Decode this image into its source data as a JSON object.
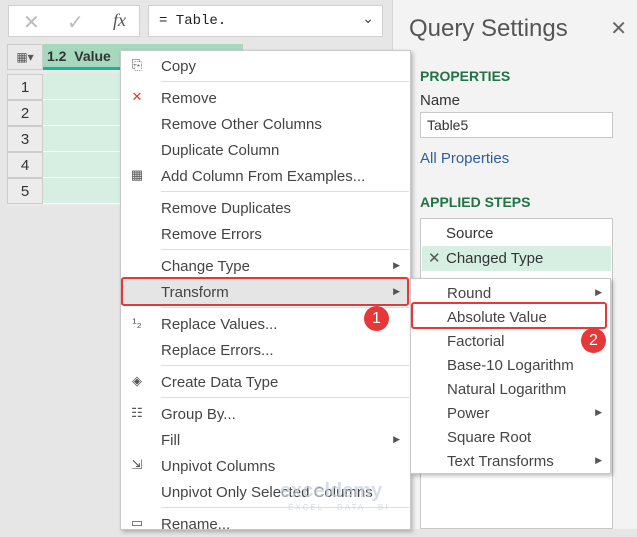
{
  "formula_bar": {
    "cancel_icon": "✕",
    "confirm_icon": "✓",
    "fx_label": "fx",
    "formula": "= Table.",
    "dropdown_icon": "⌄"
  },
  "grid": {
    "column_type": "1.2",
    "column_name": "Value",
    "rows": [
      "1",
      "2",
      "3",
      "4",
      "5"
    ]
  },
  "query_settings": {
    "title": "Query Settings",
    "close": "✕",
    "properties_heading": "PROPERTIES",
    "name_label": "Name",
    "name_value": "Table5",
    "all_properties": "All Properties",
    "applied_steps_heading": "APPLIED STEPS",
    "steps": [
      "Source",
      "Changed Type"
    ]
  },
  "context_menu": {
    "items": [
      "Copy",
      "Remove",
      "Remove Other Columns",
      "Duplicate Column",
      "Add Column From Examples...",
      "Remove Duplicates",
      "Remove Errors",
      "Change Type",
      "Transform",
      "Replace Values...",
      "Replace Errors...",
      "Create Data Type",
      "Group By...",
      "Fill",
      "Unpivot Columns",
      "Unpivot Only Selected Columns",
      "Rename..."
    ],
    "highlighted": "Transform"
  },
  "transform_submenu": {
    "items": [
      "Round",
      "Absolute Value",
      "Factorial",
      "Base-10 Logarithm",
      "Natural Logarithm",
      "Power",
      "Square Root",
      "Text Transforms"
    ],
    "highlighted": "Absolute Value"
  },
  "badges": [
    "1",
    "2"
  ],
  "accent_colors": {
    "green": "#217346",
    "highlight": "#d6efe2",
    "callout": "#e63838"
  },
  "watermark": {
    "name": "exceldemy",
    "tagline": "EXCEL · DATA · BI"
  }
}
